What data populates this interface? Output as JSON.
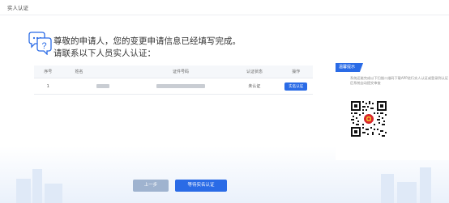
{
  "breadcrumb": {
    "title": "实人认证"
  },
  "hero": {
    "line1": "尊敬的申请人，您的变更申请信息已经填写完成。",
    "line2": "请联系以下人员实人认证："
  },
  "table": {
    "headers": [
      "序号",
      "姓名",
      "证件号码",
      "认证状态",
      "操作"
    ],
    "rows": [
      {
        "index": "1",
        "status": "未认证",
        "action": "实名认证"
      }
    ]
  },
  "tip": {
    "tag": "温馨提示",
    "text": "系统还能完成以下扫描二维码下载APP进行实人认证或登录到认证后系统自动提交审查"
  },
  "footer": {
    "prev_label": "上一步",
    "wait_label": "等待实名认证"
  },
  "colors": {
    "primary": "#2a6be6",
    "disabled": "#9fb3cf",
    "status_unverified": "#e23a3a"
  },
  "icons": {
    "hero": "question-chat-icon",
    "emblem": "national-emblem-icon"
  }
}
